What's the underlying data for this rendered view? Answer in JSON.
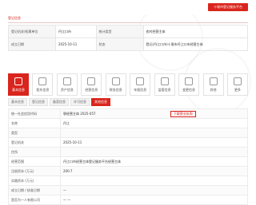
{
  "top_action": {
    "label": "十堰市登记服务平台"
  },
  "section": {
    "title": "登记信息"
  },
  "info_rows": [
    {
      "k1": "登记机关/权属单位",
      "v1": "丹江口市",
      "k2": "统计类型",
      "v2": "农村经营主体"
    },
    {
      "k1": "成立日期",
      "v1": "2025-10-11",
      "k2": "状态",
      "v2": "登记(丹江口市)十堰市丹江口市经营主体"
    }
  ],
  "tabs": [
    {
      "label": "基本信息",
      "icon": "info-icon",
      "active": true
    },
    {
      "label": "股东信息",
      "icon": "shareholder-icon",
      "active": false
    },
    {
      "label": "资产信息",
      "icon": "asset-icon",
      "active": false
    },
    {
      "label": "经营信息",
      "icon": "business-icon",
      "active": false
    },
    {
      "label": "财务信息",
      "icon": "finance-icon",
      "active": false
    },
    {
      "label": "年报信息",
      "icon": "report-icon",
      "active": false
    },
    {
      "label": "监管信息",
      "icon": "supervision-icon",
      "active": false
    },
    {
      "label": "变更信息",
      "icon": "change-icon",
      "active": false
    },
    {
      "label": "其他",
      "icon": "other-icon",
      "active": false
    },
    {
      "label": "更多",
      "icon": "more-icon",
      "active": false
    }
  ],
  "breadcrumbs": [
    {
      "label": "基本信息",
      "active": false
    },
    {
      "label": "登记信息",
      "active": false
    },
    {
      "label": "备案信息",
      "active": false
    },
    {
      "label": "许可信息",
      "active": false
    },
    {
      "label": "其他信息",
      "active": true
    }
  ],
  "detail_rows": [
    {
      "label": "统一社会信用代码",
      "value": "鄂经营主体 2025-057",
      "action": "下载营业执照"
    },
    {
      "label": "名称",
      "value": "丹江",
      "action": ""
    },
    {
      "label": "类型",
      "value": "",
      "action": ""
    },
    {
      "label": "登记机关",
      "value": "2025-10-11",
      "action": ""
    },
    {
      "label": "住所",
      "value": "",
      "action": ""
    },
    {
      "label": "经营范围",
      "value": "丹江口市经营主体登记服务平台经营主体",
      "action": ""
    },
    {
      "label": "注册资本 (万元)",
      "value": "200.7",
      "action": ""
    },
    {
      "label": "实缴资本 (万元)",
      "value": "",
      "action": ""
    },
    {
      "label": "成立日期 / 核准日期",
      "value": "—",
      "action": ""
    },
    {
      "label": "是否为一人有限公司",
      "value": "— —",
      "action": ""
    }
  ],
  "colors": {
    "accent": "#d9251d",
    "panel": "#f6f6f6",
    "border": "#e6e6e6"
  }
}
